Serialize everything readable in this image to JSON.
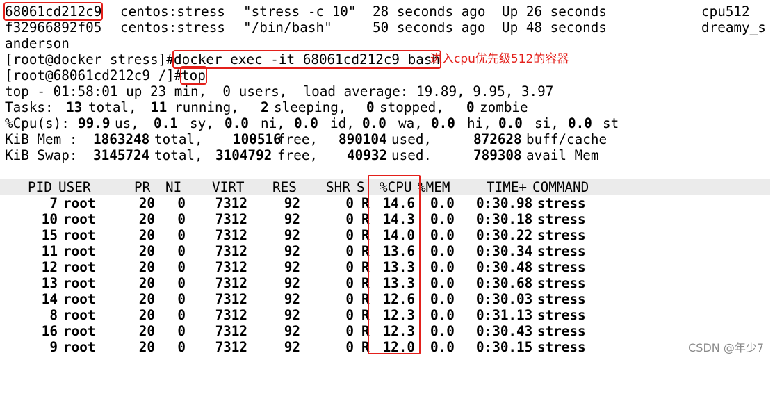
{
  "docker_ps": {
    "row1": {
      "id": "68061cd212c9",
      "image": "centos:stress",
      "command": "\"stress -c 10\"",
      "created": "28 seconds ago",
      "status": "Up 26 seconds",
      "name": "cpu512"
    },
    "row2": {
      "id": "f32966892f05",
      "image": "centos:stress",
      "command": "\"/bin/bash\"",
      "created": "50 seconds ago",
      "status": "Up 48 seconds",
      "name_part1": "dreamy_s",
      "name_part2": "anderson"
    }
  },
  "exec_prompt": "[root@docker stress]#",
  "exec_command": "docker exec -it 68061cd212c9 bash",
  "exec_annotation": "进入cpu优先级512的容器",
  "container_prompt": "[root@68061cd212c9 /]#",
  "container_command": "top",
  "top_summary": {
    "uptime": "top - 01:58:01 up 23 min,  0 users,  load average: 19.89, 9.95, 3.97",
    "tasks": {
      "label": "Tasks:",
      "total": "13",
      "total_label": "total,",
      "running": "11",
      "running_label": "running,",
      "sleeping": "2",
      "sleeping_label": "sleeping,",
      "stopped": "0",
      "stopped_label": "stopped,",
      "zombie": "0",
      "zombie_label": "zombie"
    },
    "cpu": {
      "label": "%Cpu(s):",
      "us": "99.9",
      "sy": "0.1",
      "ni": "0.0",
      "id": "0.0",
      "wa": "0.0",
      "hi": "0.0",
      "si": "0.0",
      "st": "0.0"
    },
    "mem": {
      "label": "KiB Mem :",
      "total": "1863248",
      "free": "100516",
      "used": "890104",
      "buff": "872628"
    },
    "swap": {
      "label": "KiB Swap:",
      "total": "3145724",
      "free": "3104792",
      "used": "40932",
      "avail": "789308"
    }
  },
  "columns": {
    "pid": "PID",
    "user": "USER",
    "pr": "PR",
    "ni": "NI",
    "virt": "VIRT",
    "res": "RES",
    "shr": "SHR",
    "s": "S",
    "cpu": "%CPU",
    "mem": "%MEM",
    "time": "TIME+",
    "command": "COMMAND"
  },
  "processes": [
    {
      "pid": "7",
      "user": "root",
      "pr": "20",
      "ni": "0",
      "virt": "7312",
      "res": "92",
      "shr": "0",
      "s": "R",
      "cpu": "14.6",
      "mem": "0.0",
      "time": "0:30.98",
      "command": "stress"
    },
    {
      "pid": "10",
      "user": "root",
      "pr": "20",
      "ni": "0",
      "virt": "7312",
      "res": "92",
      "shr": "0",
      "s": "R",
      "cpu": "14.3",
      "mem": "0.0",
      "time": "0:30.18",
      "command": "stress"
    },
    {
      "pid": "15",
      "user": "root",
      "pr": "20",
      "ni": "0",
      "virt": "7312",
      "res": "92",
      "shr": "0",
      "s": "R",
      "cpu": "14.0",
      "mem": "0.0",
      "time": "0:30.22",
      "command": "stress"
    },
    {
      "pid": "11",
      "user": "root",
      "pr": "20",
      "ni": "0",
      "virt": "7312",
      "res": "92",
      "shr": "0",
      "s": "R",
      "cpu": "13.6",
      "mem": "0.0",
      "time": "0:30.34",
      "command": "stress"
    },
    {
      "pid": "12",
      "user": "root",
      "pr": "20",
      "ni": "0",
      "virt": "7312",
      "res": "92",
      "shr": "0",
      "s": "R",
      "cpu": "13.3",
      "mem": "0.0",
      "time": "0:30.48",
      "command": "stress"
    },
    {
      "pid": "13",
      "user": "root",
      "pr": "20",
      "ni": "0",
      "virt": "7312",
      "res": "92",
      "shr": "0",
      "s": "R",
      "cpu": "13.3",
      "mem": "0.0",
      "time": "0:30.68",
      "command": "stress"
    },
    {
      "pid": "14",
      "user": "root",
      "pr": "20",
      "ni": "0",
      "virt": "7312",
      "res": "92",
      "shr": "0",
      "s": "R",
      "cpu": "12.6",
      "mem": "0.0",
      "time": "0:30.03",
      "command": "stress"
    },
    {
      "pid": "8",
      "user": "root",
      "pr": "20",
      "ni": "0",
      "virt": "7312",
      "res": "92",
      "shr": "0",
      "s": "R",
      "cpu": "12.3",
      "mem": "0.0",
      "time": "0:31.13",
      "command": "stress"
    },
    {
      "pid": "16",
      "user": "root",
      "pr": "20",
      "ni": "0",
      "virt": "7312",
      "res": "92",
      "shr": "0",
      "s": "R",
      "cpu": "12.3",
      "mem": "0.0",
      "time": "0:30.43",
      "command": "stress"
    },
    {
      "pid": "9",
      "user": "root",
      "pr": "20",
      "ni": "0",
      "virt": "7312",
      "res": "92",
      "shr": "0",
      "s": "R",
      "cpu": "12.0",
      "mem": "0.0",
      "time": "0:30.15",
      "command": "stress"
    }
  ],
  "watermark": "CSDN @年少7",
  "colors": {
    "annotation_red": "#e3201b",
    "header_bg": "#ebebeb",
    "watermark": "#8a8a8a"
  }
}
